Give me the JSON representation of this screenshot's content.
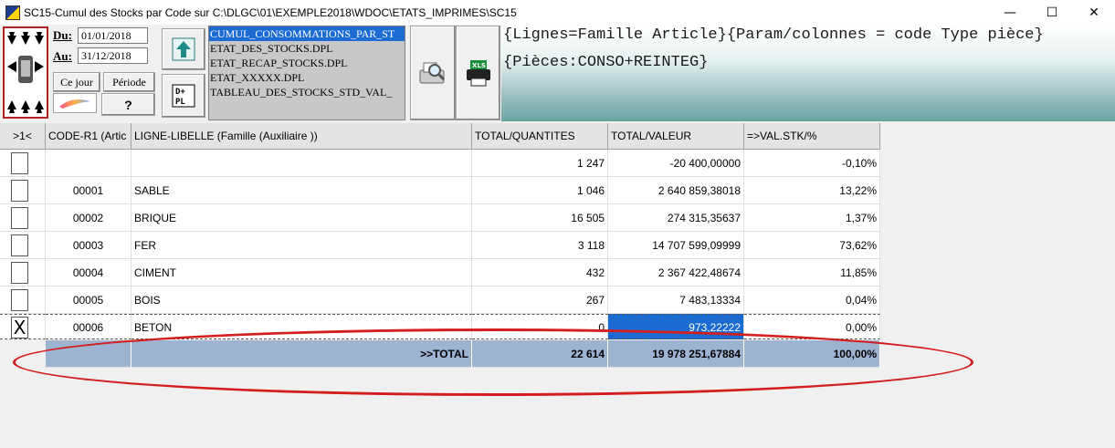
{
  "window": {
    "title": "SC15-Cumul des Stocks par Code sur C:\\DLGC\\01\\EXEMPLE2018\\WDOC\\ETATS_IMPRIMES\\SC15",
    "controls": {
      "minimize": "—",
      "maximize": "☐",
      "close": "✕"
    }
  },
  "toolbar": {
    "du_label": "Du:",
    "du_value": "01/01/2018",
    "au_label": "Au:",
    "au_value": "31/12/2018",
    "ce_jour_label": "Ce jour",
    "periode_label": "Période",
    "help_label": "?",
    "icons": [
      "navigation-arrows-icon",
      "palette-icon",
      "upload-arrow-icon",
      "dplus-pl-icon",
      "preview-magnifier-icon",
      "xls-printer-icon"
    ]
  },
  "files": [
    "CUMUL_CONSOMMATIONS_PAR_ST",
    "ETAT_DES_STOCKS.DPL",
    "ETAT_RECAP_STOCKS.DPL",
    "ETAT_XXXXX.DPL",
    "TABLEAU_DES_STOCKS_STD_VAL_"
  ],
  "header": {
    "line1": "{Lignes=Famille Article}{Param/colonnes = code Type pièce}",
    "line2": "{Pièces:CONSO+REINTEG}"
  },
  "columns": [
    ">1<",
    "CODE-R1 (Artic",
    "LIGNE-LIBELLE (Famille (Auxiliaire ))",
    "TOTAL/QUANTITES",
    "TOTAL/VALEUR",
    "=>VAL.STK/%"
  ],
  "rows": [
    {
      "check": "",
      "code": "",
      "libelle": "",
      "qte": "1 247",
      "valeur": "-20 400,00000",
      "pct": "-0,10%"
    },
    {
      "check": "",
      "code": "00001",
      "libelle": "SABLE",
      "qte": "1 046",
      "valeur": "2 640 859,38018",
      "pct": "13,22%"
    },
    {
      "check": "",
      "code": "00002",
      "libelle": "BRIQUE",
      "qte": "16 505",
      "valeur": "274 315,35637",
      "pct": "1,37%"
    },
    {
      "check": "",
      "code": "00003",
      "libelle": "FER",
      "qte": "3 118",
      "valeur": "14 707 599,09999",
      "pct": "73,62%"
    },
    {
      "check": "",
      "code": "00004",
      "libelle": "CIMENT",
      "qte": "432",
      "valeur": "2 367 422,48674",
      "pct": "11,85%"
    },
    {
      "check": "",
      "code": "00005",
      "libelle": "BOIS",
      "qte": "267",
      "valeur": "7 483,13334",
      "pct": "0,04%"
    },
    {
      "check": "X",
      "code": "00006",
      "libelle": "BETON",
      "qte": "0",
      "valeur": "973,22222",
      "pct": "0,00%"
    }
  ],
  "total": {
    "label": ">>TOTAL",
    "qte": "22 614",
    "valeur": "19 978 251,67884",
    "pct": "100,00%"
  },
  "colors": {
    "selection": "#1c6bd3",
    "total_row": "#9cb3d1",
    "annotation": "#d31e1e"
  }
}
